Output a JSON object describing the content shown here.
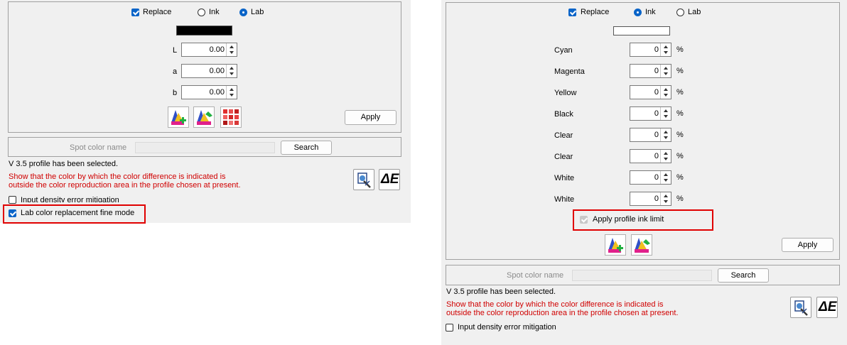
{
  "left": {
    "replace_label": "Replace",
    "ink_label": "Ink",
    "lab_label": "Lab",
    "swatch_color": "#000000",
    "fields": [
      {
        "label": "L",
        "value": "0.00"
      },
      {
        "label": "a",
        "value": "0.00"
      },
      {
        "label": "b",
        "value": "0.00"
      }
    ],
    "apply_label": "Apply",
    "spot_label": "Spot color name",
    "spot_value": "",
    "search_label": "Search",
    "status_text": "V 3.5 profile has been selected.",
    "warning_line1": "Show that the color by which the color difference is indicated is",
    "warning_line2": "outside the color reproduction area in the profile chosen at present.",
    "density_label": "Input density error mitigation",
    "fine_mode_label": "Lab color replacement fine mode",
    "tools": [
      "profile-add-icon",
      "profile-edit-icon",
      "color-grid-icon"
    ],
    "side_tools": [
      "profile-inspect-icon",
      "delta-e-icon"
    ],
    "delta_e": "ΔE"
  },
  "right": {
    "replace_label": "Replace",
    "ink_label": "Ink",
    "lab_label": "Lab",
    "swatch_color": "#ffffff",
    "inks": [
      {
        "label": "Cyan",
        "value": "0",
        "unit": "%"
      },
      {
        "label": "Magenta",
        "value": "0",
        "unit": "%"
      },
      {
        "label": "Yellow",
        "value": "0",
        "unit": "%"
      },
      {
        "label": "Black",
        "value": "0",
        "unit": "%"
      },
      {
        "label": "Clear",
        "value": "0",
        "unit": "%"
      },
      {
        "label": "Clear",
        "value": "0",
        "unit": "%"
      },
      {
        "label": "White",
        "value": "0",
        "unit": "%"
      },
      {
        "label": "White",
        "value": "0",
        "unit": "%"
      }
    ],
    "ink_limit_label": "Apply profile ink limit",
    "apply_label": "Apply",
    "spot_label": "Spot color name",
    "spot_value": "",
    "search_label": "Search",
    "status_text": "V 3.5 profile has been selected.",
    "warning_line1": "Show that the color by which the color difference is indicated is",
    "warning_line2": "outside the color reproduction area in the profile chosen at present.",
    "density_label": "Input density error mitigation",
    "delta_e": "ΔE"
  },
  "colors": {
    "accent": "#0a64c8",
    "highlight": "#e00000",
    "warning": "#d00000"
  }
}
